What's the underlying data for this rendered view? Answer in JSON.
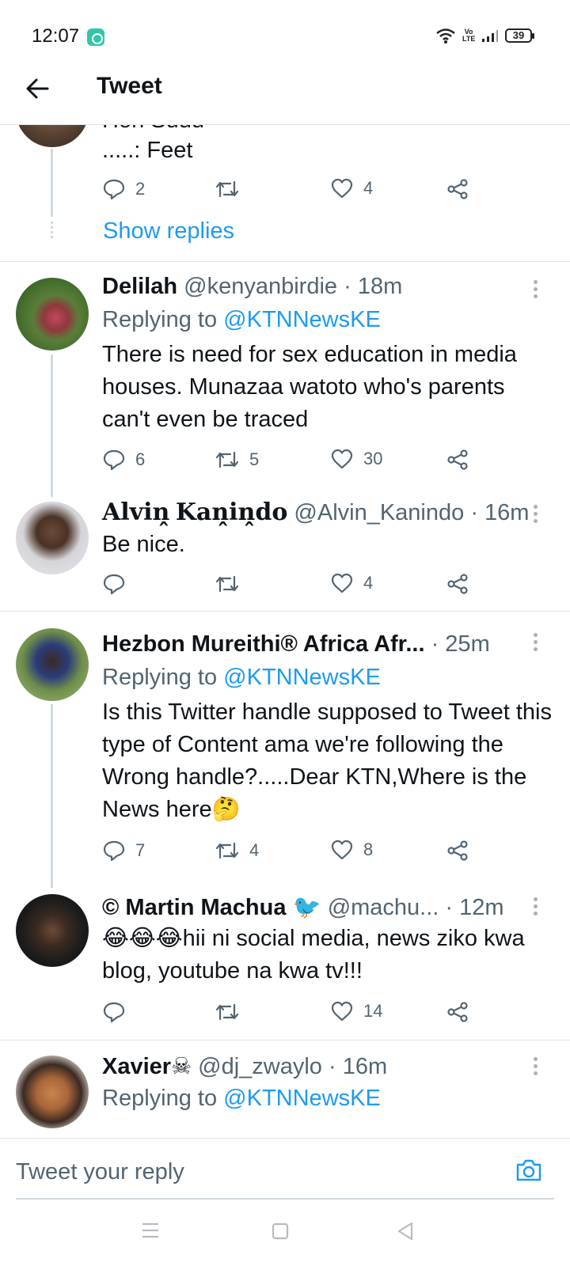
{
  "status_bar": {
    "time": "12:07",
    "volte_label": "Vo LTE",
    "battery": "39"
  },
  "header": {
    "title": "Tweet",
    "back_icon": "arrow-left-icon"
  },
  "prev_tweet": {
    "partial_text": "Hon Sudu",
    "text": ".....: Feet",
    "reply_count": "2",
    "retweet_count": "",
    "like_count": "4",
    "show_replies": "Show replies"
  },
  "tweets": [
    {
      "name": "Delilah",
      "handle": "@kenyanbirdie",
      "time": "· 18m",
      "replying_prefix": "Replying to",
      "replying_to": "@KTNNewsKE",
      "text": "There is need for sex education in media houses. Munazaa watoto who's parents can't even be traced",
      "reply_count": "6",
      "retweet_count": "5",
      "like_count": "30"
    },
    {
      "name": "𝐀𝐥𝐯𝐢𝐧̭ 𝐊𝐚𝐧̭𝐢𝐧̭𝐝𝐨",
      "handle": "@Alvin_Kanindo",
      "time": "· 16m",
      "text": "Be nice.",
      "reply_count": "",
      "retweet_count": "",
      "like_count": "4"
    },
    {
      "name": "Hezbon Mureithi® Africa Afr...",
      "handle": "",
      "time": "· 25m",
      "replying_prefix": "Replying to",
      "replying_to": "@KTNNewsKE",
      "text": "Is this Twitter handle supposed to Tweet this type of Content ama we're following the Wrong handle?.....Dear KTN,Where is the News here🤔",
      "reply_count": "7",
      "retweet_count": "4",
      "like_count": "8"
    },
    {
      "name": "© Martin Machua 🐦",
      "handle": "@machu...",
      "time": "· 12m",
      "text": "😂😂😂hii ni social media, news ziko kwa blog, youtube na kwa tv!!!",
      "reply_count": "",
      "retweet_count": "",
      "like_count": "14"
    },
    {
      "name": "Xavier☠",
      "handle": "@dj_zwaylo",
      "time": "· 16m",
      "replying_prefix": "Replying to",
      "replying_to": "@KTNNewsKE"
    }
  ],
  "composer": {
    "placeholder": "Tweet your reply",
    "camera_icon": "camera-icon"
  },
  "colors": {
    "accent": "#1d9bf0",
    "text_primary": "#0f1419",
    "text_secondary": "#536471",
    "divider": "#e1e4e6"
  }
}
